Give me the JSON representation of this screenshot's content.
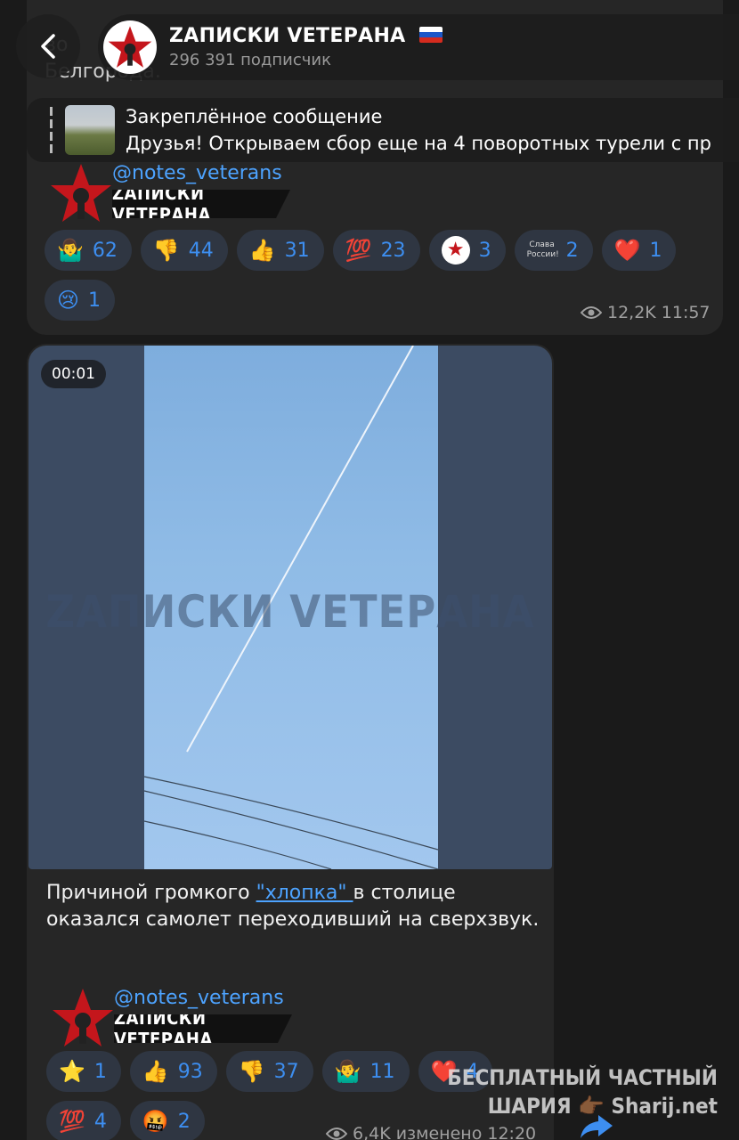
{
  "header": {
    "channel_name": "ZАПИСКИ VЕТЕРАНА",
    "subscribers": "296 391 подписчик",
    "flag_colors": [
      "#ffffff",
      "#1c57c8",
      "#d52b1e"
    ]
  },
  "pinned": {
    "title": "Закреплённое сообщение",
    "text": "Друзья! Открываем сбор еще на 4 поворотных турели с пр"
  },
  "post1": {
    "partial_text_1": "во",
    "partial_text_2": "Белгорода.",
    "signature_handle": "@notes_veterans",
    "signature_banner": "ZАПИСКИ VЕТЕРАНА",
    "reactions": [
      {
        "icon": "shrug",
        "emoji": "🤷‍♂️",
        "count": "62"
      },
      {
        "icon": "thumbs-down",
        "emoji": "👎",
        "count": "44"
      },
      {
        "icon": "thumbs-up",
        "emoji": "👍",
        "count": "31"
      },
      {
        "icon": "hundred",
        "emoji": "💯",
        "count": "23"
      },
      {
        "icon": "channel-logo",
        "emoji": "★",
        "count": "3"
      },
      {
        "icon": "slava-rossii-sticker",
        "emoji": "Слава России!",
        "count": "2"
      },
      {
        "icon": "heart",
        "emoji": "❤️",
        "count": "1"
      },
      {
        "icon": "crying",
        "emoji": "😢",
        "count": "1"
      }
    ],
    "views": "12,2K",
    "time": "11:57"
  },
  "post2": {
    "video_timer": "00:01",
    "video_watermark": "ZАПИСКИ VЕТЕРАНА",
    "caption_before": "Причиной громкого ",
    "caption_link": "\"хлопка\" ",
    "caption_after": "в столице оказался самолет переходивший на сверхзвук.",
    "signature_handle": "@notes_veterans",
    "signature_banner": "ZАПИСКИ VЕТЕРАНА",
    "reactions": [
      {
        "icon": "star-struck",
        "emoji": "⭐",
        "count": "1"
      },
      {
        "icon": "thumbs-up",
        "emoji": "👍",
        "count": "93"
      },
      {
        "icon": "thumbs-down",
        "emoji": "👎",
        "count": "37"
      },
      {
        "icon": "shrug",
        "emoji": "🤷‍♂️",
        "count": "11"
      },
      {
        "icon": "heart",
        "emoji": "❤️",
        "count": "4"
      },
      {
        "icon": "hundred",
        "emoji": "💯",
        "count": "4"
      },
      {
        "icon": "angry-cursing",
        "emoji": "🤬",
        "count": "2"
      }
    ],
    "views": "6,4K",
    "edited_time": "изменено 12:20"
  },
  "overlay_watermark": {
    "line1": "БЕСПЛАТНЫЙ ЧАСТНЫЙ",
    "line2": "ШАРИЯ 👉🏾 Sharij.net"
  },
  "colors": {
    "accent": "#3d8ef0",
    "link": "#4da3ff",
    "bubble": "#262626",
    "reaction_bg": "#2f3642"
  }
}
